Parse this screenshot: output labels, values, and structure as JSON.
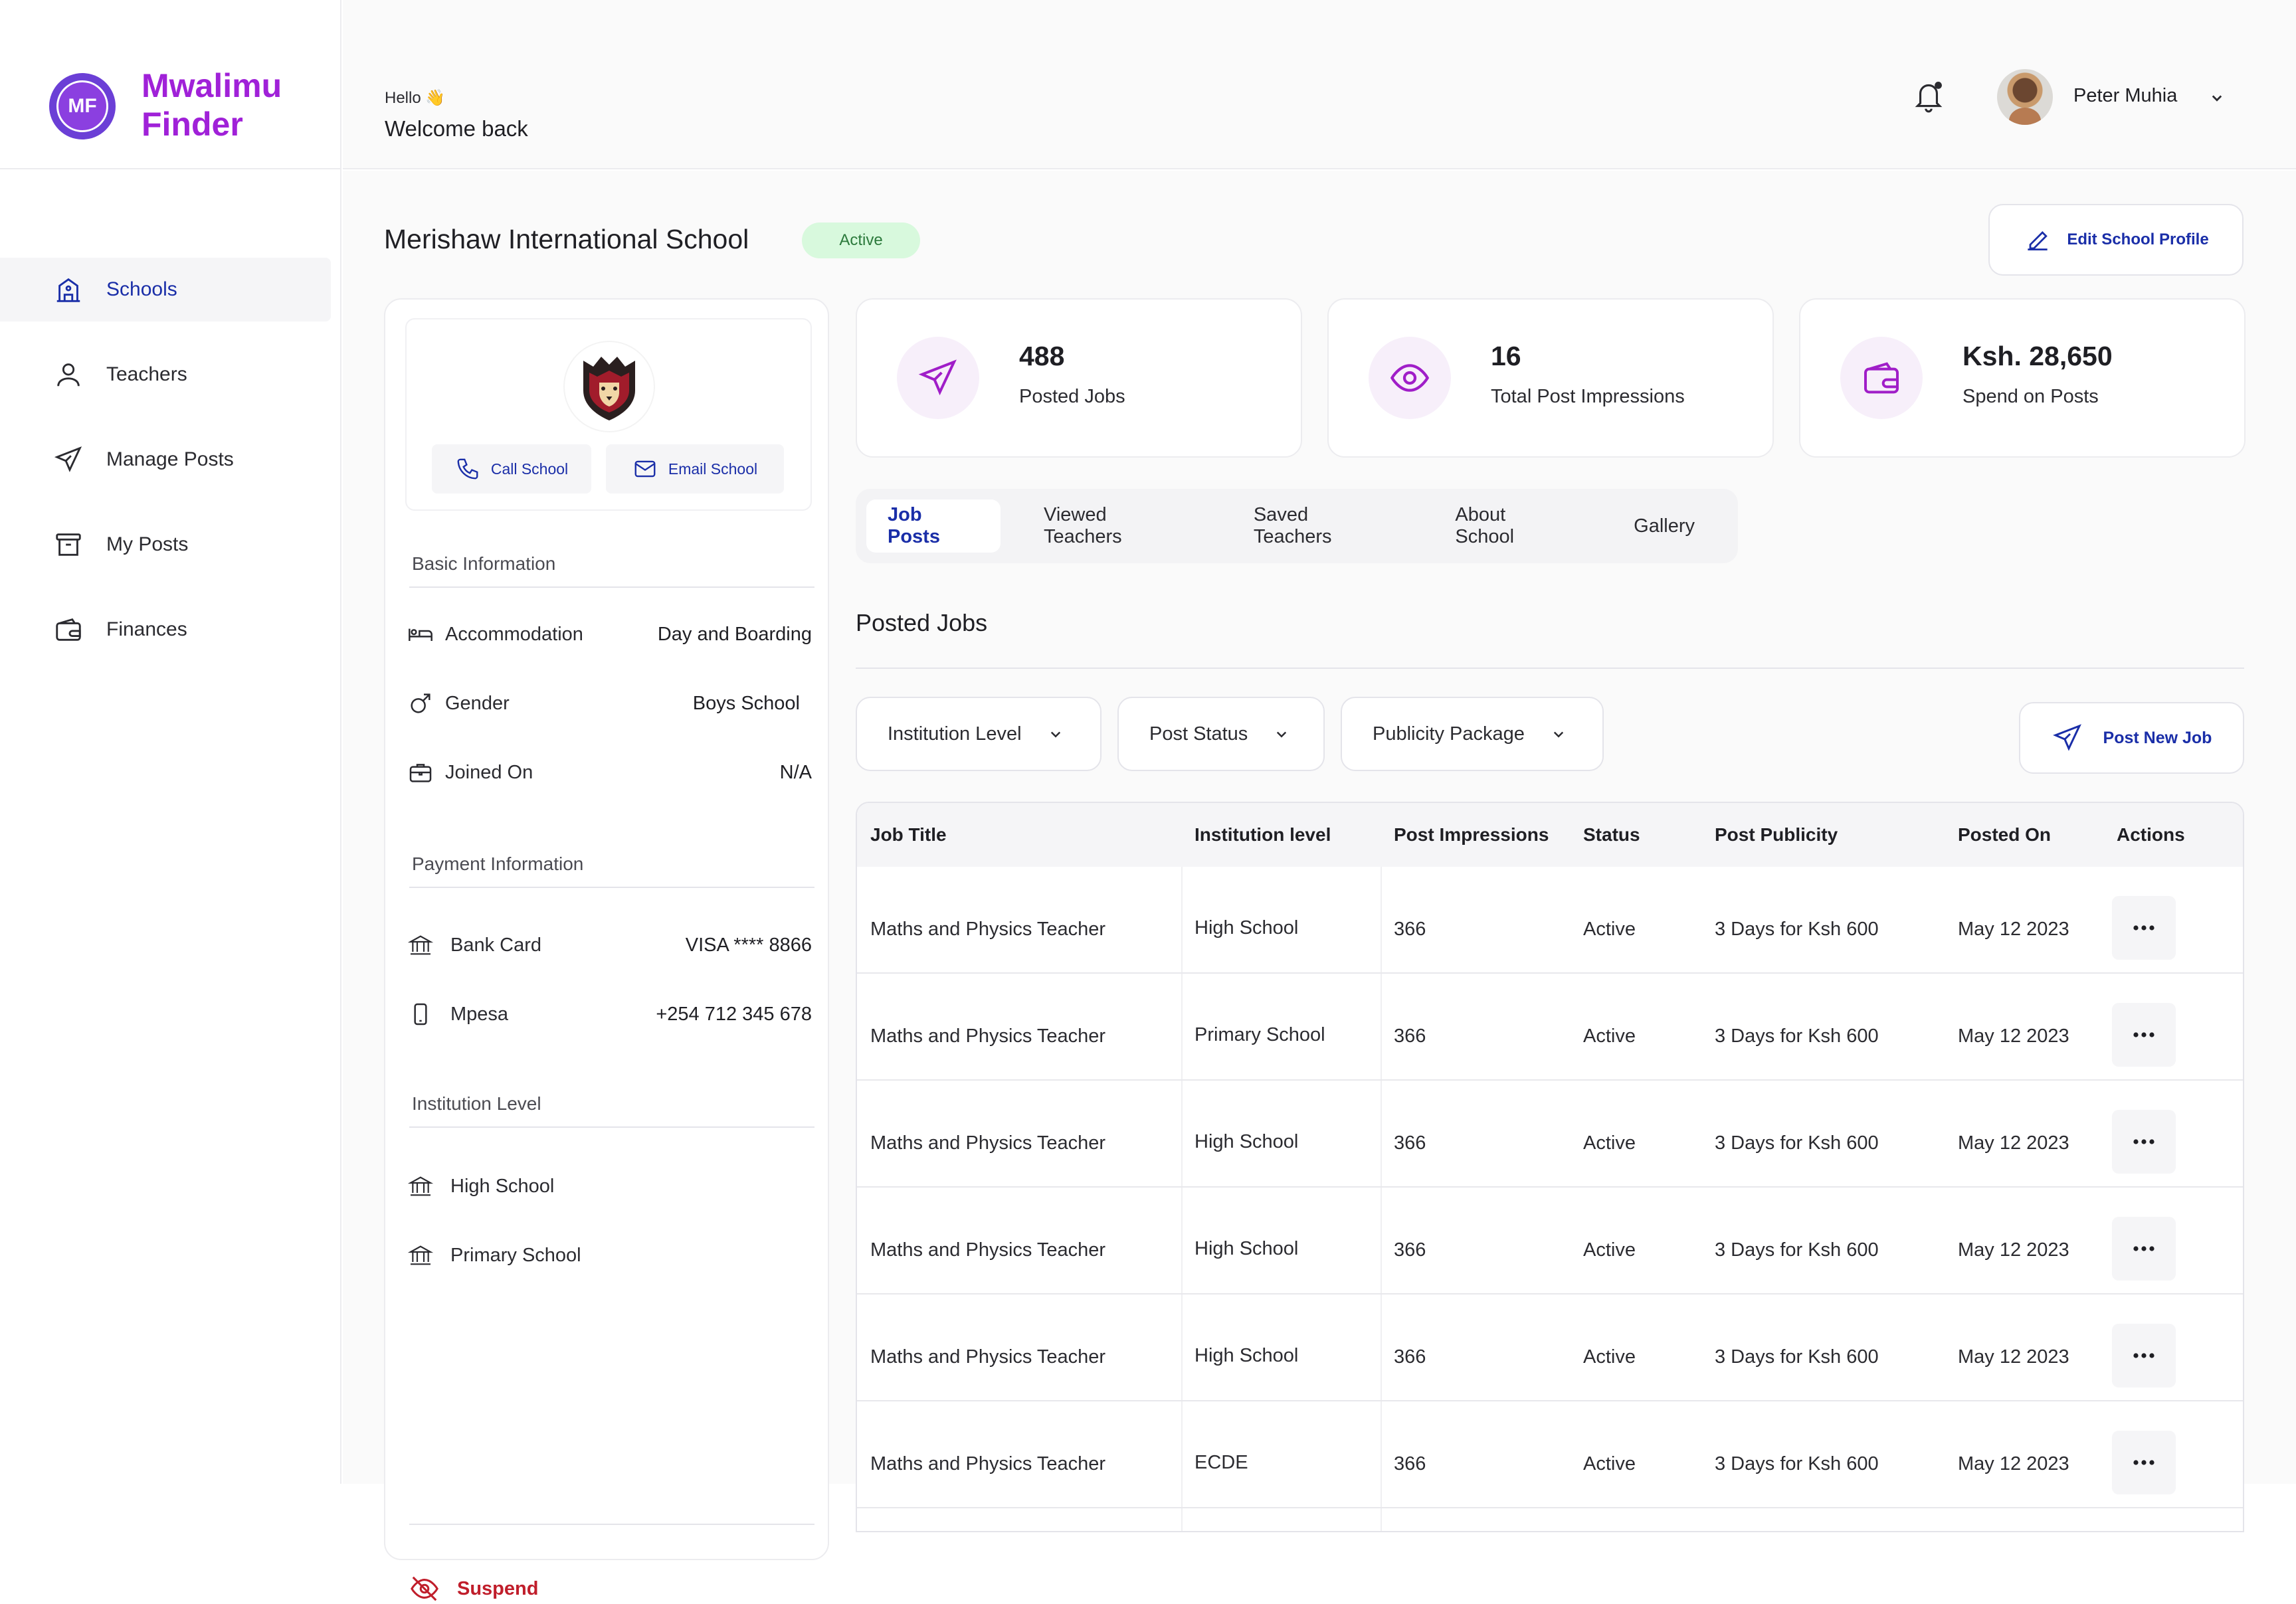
{
  "brand": {
    "name_line1": "Mwalimu",
    "name_line2": "Finder",
    "logo_initials": "MF"
  },
  "sidebar": {
    "items": [
      {
        "label": "Schools",
        "icon": "school-icon",
        "active": true
      },
      {
        "label": "Teachers",
        "icon": "user-icon",
        "active": false
      },
      {
        "label": "Manage Posts",
        "icon": "send-icon",
        "active": false
      },
      {
        "label": "My Posts",
        "icon": "archive-icon",
        "active": false
      },
      {
        "label": "Finances",
        "icon": "wallet-icon",
        "active": false
      }
    ]
  },
  "topbar": {
    "greeting": "Hello 👋",
    "welcome": "Welcome back",
    "user_name": "Peter Muhia"
  },
  "school": {
    "name": "Merishaw International School",
    "status": "Active",
    "edit_label": "Edit School Profile",
    "call_label": "Call School",
    "email_label": "Email School"
  },
  "basic_info": {
    "title": "Basic Information",
    "rows": [
      {
        "label": "Accommodation",
        "value": "Day and Boarding",
        "icon": "bed-icon"
      },
      {
        "label": "Gender",
        "value": "Boys School",
        "icon": "male-icon"
      },
      {
        "label": "Joined On",
        "value": "N/A",
        "icon": "briefcase-icon"
      }
    ]
  },
  "payment_info": {
    "title": "Payment Information",
    "rows": [
      {
        "label": "Bank Card",
        "value": "VISA **** 8866",
        "icon": "bank-icon"
      },
      {
        "label": "Mpesa",
        "value": "+254 712 345 678",
        "icon": "phone-device-icon"
      }
    ]
  },
  "institution_level": {
    "title": "Institution Level",
    "rows": [
      {
        "label": "High School",
        "icon": "bank-icon"
      },
      {
        "label": "Primary School",
        "icon": "bank-icon"
      }
    ]
  },
  "suspend_label": "Suspend",
  "stats": [
    {
      "value": "488",
      "label": "Posted Jobs",
      "icon": "send-icon"
    },
    {
      "value": "16",
      "label": "Total Post Impressions",
      "icon": "eye-icon"
    },
    {
      "value": "Ksh. 28,650",
      "label": "Spend on Posts",
      "icon": "wallet-icon"
    }
  ],
  "tabs": [
    {
      "label": "Job Posts",
      "active": true
    },
    {
      "label": "Viewed Teachers",
      "active": false
    },
    {
      "label": "Saved Teachers",
      "active": false
    },
    {
      "label": "About School",
      "active": false
    },
    {
      "label": "Gallery",
      "active": false
    }
  ],
  "posted_jobs_title": "Posted Jobs",
  "filters": [
    {
      "label": "Institution Level"
    },
    {
      "label": "Post Status"
    },
    {
      "label": "Publicity Package"
    }
  ],
  "post_new_job_label": "Post New Job",
  "table": {
    "headers": [
      "Job Title",
      "Institution level",
      "Post Impressions",
      "Status",
      "Post Publicity",
      "Posted On",
      "Actions"
    ],
    "rows": [
      [
        "Maths and Physics Teacher",
        "High School",
        "366",
        "Active",
        "3 Days for Ksh 600",
        "May 12 2023"
      ],
      [
        "Maths and Physics Teacher",
        "Primary School",
        "366",
        "Active",
        "3 Days for Ksh 600",
        "May 12 2023"
      ],
      [
        "Maths and Physics Teacher",
        "High School",
        "366",
        "Active",
        "3 Days for Ksh 600",
        "May 12 2023"
      ],
      [
        "Maths and Physics Teacher",
        "High School",
        "366",
        "Active",
        "3 Days for Ksh 600",
        "May 12 2023"
      ],
      [
        "Maths and Physics Teacher",
        "High School",
        "366",
        "Active",
        "3 Days for Ksh 600",
        "May 12 2023"
      ],
      [
        "Maths and Physics Teacher",
        "ECDE",
        "366",
        "Active",
        "3 Days for Ksh 600",
        "May 12 2023"
      ]
    ]
  },
  "colors": {
    "brand": "#a021d8",
    "accent": "#1a2ea8",
    "success_bg": "#d8f9dd",
    "danger": "#c01e2b",
    "icon_purple": "#a01ec8"
  }
}
